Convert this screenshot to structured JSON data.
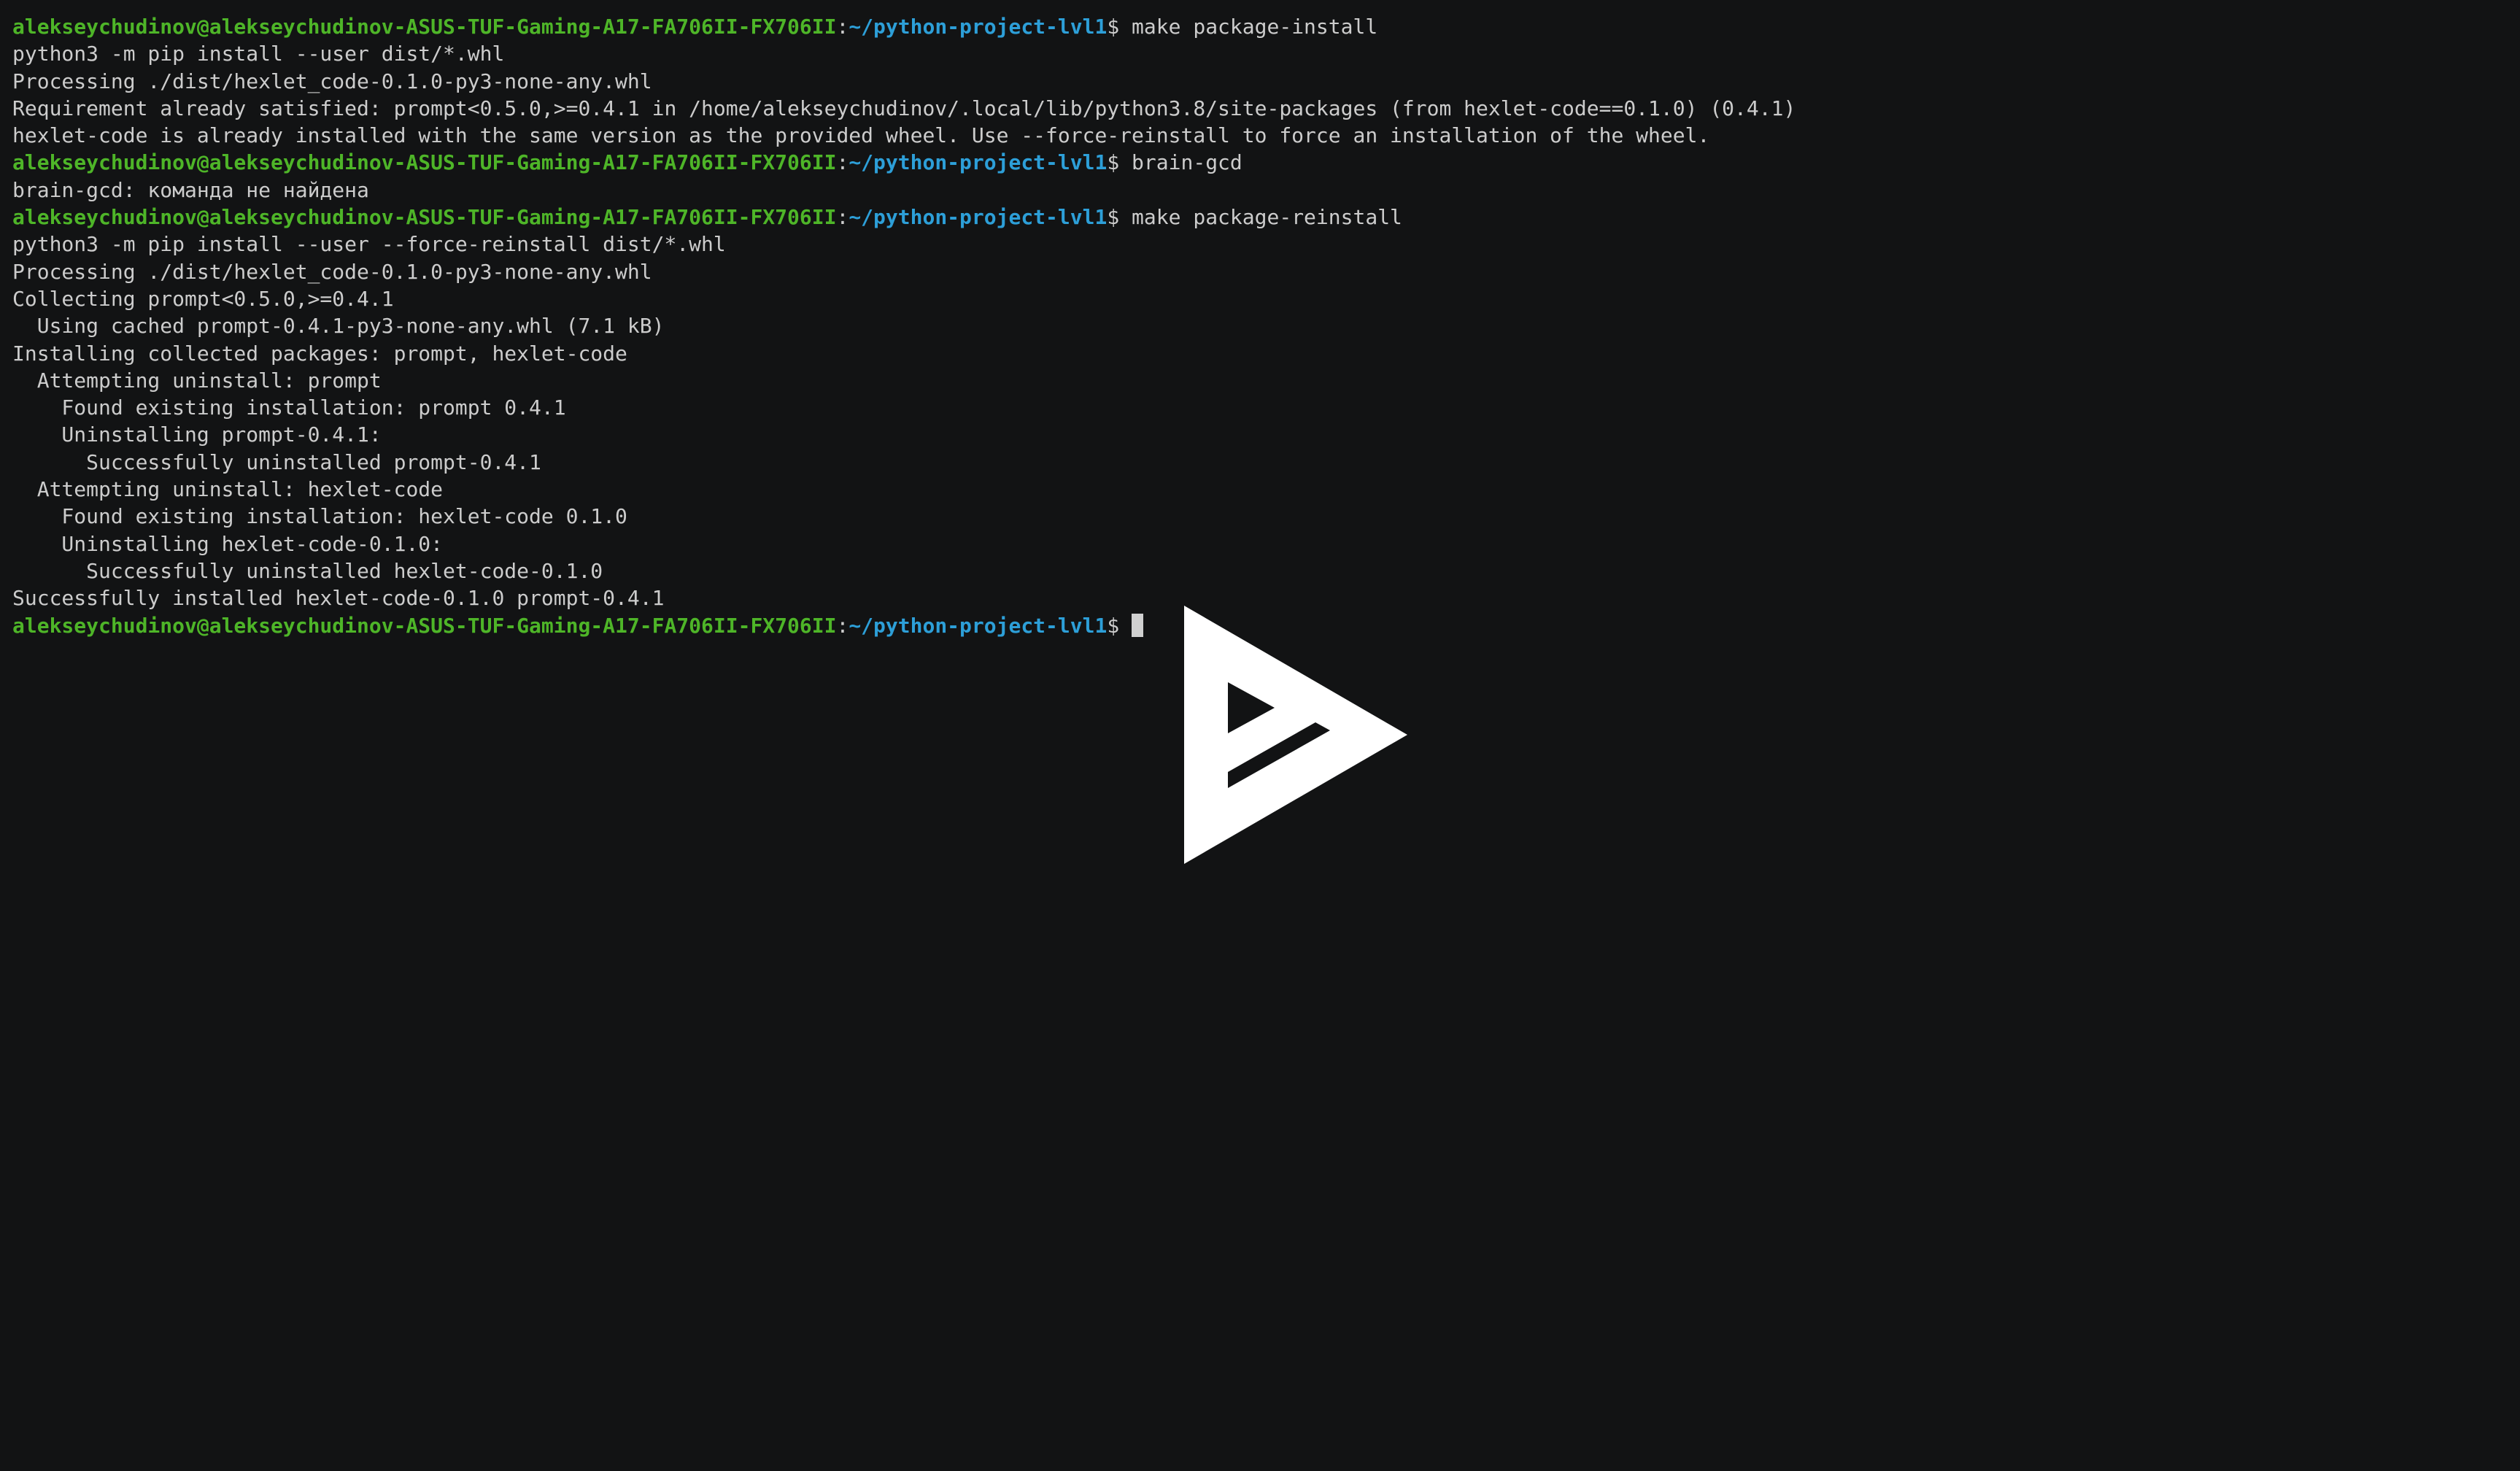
{
  "prompt": {
    "user_host": "alekseychudinov@alekseychudinov-ASUS-TUF-Gaming-A17-FA706II-FX706II",
    "colon": ":",
    "path": "~/python-project-lvl1",
    "dollar": "$"
  },
  "lines": [
    {
      "type": "prompt",
      "command": " make package-install"
    },
    {
      "type": "output",
      "text": "python3 -m pip install --user dist/*.whl"
    },
    {
      "type": "output",
      "text": "Processing ./dist/hexlet_code-0.1.0-py3-none-any.whl"
    },
    {
      "type": "output",
      "text": "Requirement already satisfied: prompt<0.5.0,>=0.4.1 in /home/alekseychudinov/.local/lib/python3.8/site-packages (from hexlet-code==0.1.0) (0.4.1)"
    },
    {
      "type": "output",
      "text": "hexlet-code is already installed with the same version as the provided wheel. Use --force-reinstall to force an installation of the wheel."
    },
    {
      "type": "prompt",
      "command": " brain-gcd"
    },
    {
      "type": "output",
      "text": "brain-gcd: команда не найдена"
    },
    {
      "type": "prompt",
      "command": " make package-reinstall"
    },
    {
      "type": "output",
      "text": "python3 -m pip install --user --force-reinstall dist/*.whl"
    },
    {
      "type": "output",
      "text": "Processing ./dist/hexlet_code-0.1.0-py3-none-any.whl"
    },
    {
      "type": "output",
      "text": "Collecting prompt<0.5.0,>=0.4.1"
    },
    {
      "type": "output",
      "text": "  Using cached prompt-0.4.1-py3-none-any.whl (7.1 kB)"
    },
    {
      "type": "output",
      "text": "Installing collected packages: prompt, hexlet-code"
    },
    {
      "type": "output",
      "text": "  Attempting uninstall: prompt"
    },
    {
      "type": "output",
      "text": "    Found existing installation: prompt 0.4.1"
    },
    {
      "type": "output",
      "text": "    Uninstalling prompt-0.4.1:"
    },
    {
      "type": "output",
      "text": "      Successfully uninstalled prompt-0.4.1"
    },
    {
      "type": "output",
      "text": "  Attempting uninstall: hexlet-code"
    },
    {
      "type": "output",
      "text": "    Found existing installation: hexlet-code 0.1.0"
    },
    {
      "type": "output",
      "text": "    Uninstalling hexlet-code-0.1.0:"
    },
    {
      "type": "output",
      "text": "      Successfully uninstalled hexlet-code-0.1.0"
    },
    {
      "type": "output",
      "text": "Successfully installed hexlet-code-0.1.0 prompt-0.4.1"
    },
    {
      "type": "prompt",
      "command": " ",
      "cursor": true
    }
  ],
  "colors": {
    "background": "#121314",
    "text": "#cccccc",
    "user_host": "#4eb528",
    "path": "#2d9fd8",
    "cursor": "#d0d0d0",
    "play_icon": "#ffffff"
  },
  "overlay": {
    "icon": "asciinema-play-icon"
  }
}
